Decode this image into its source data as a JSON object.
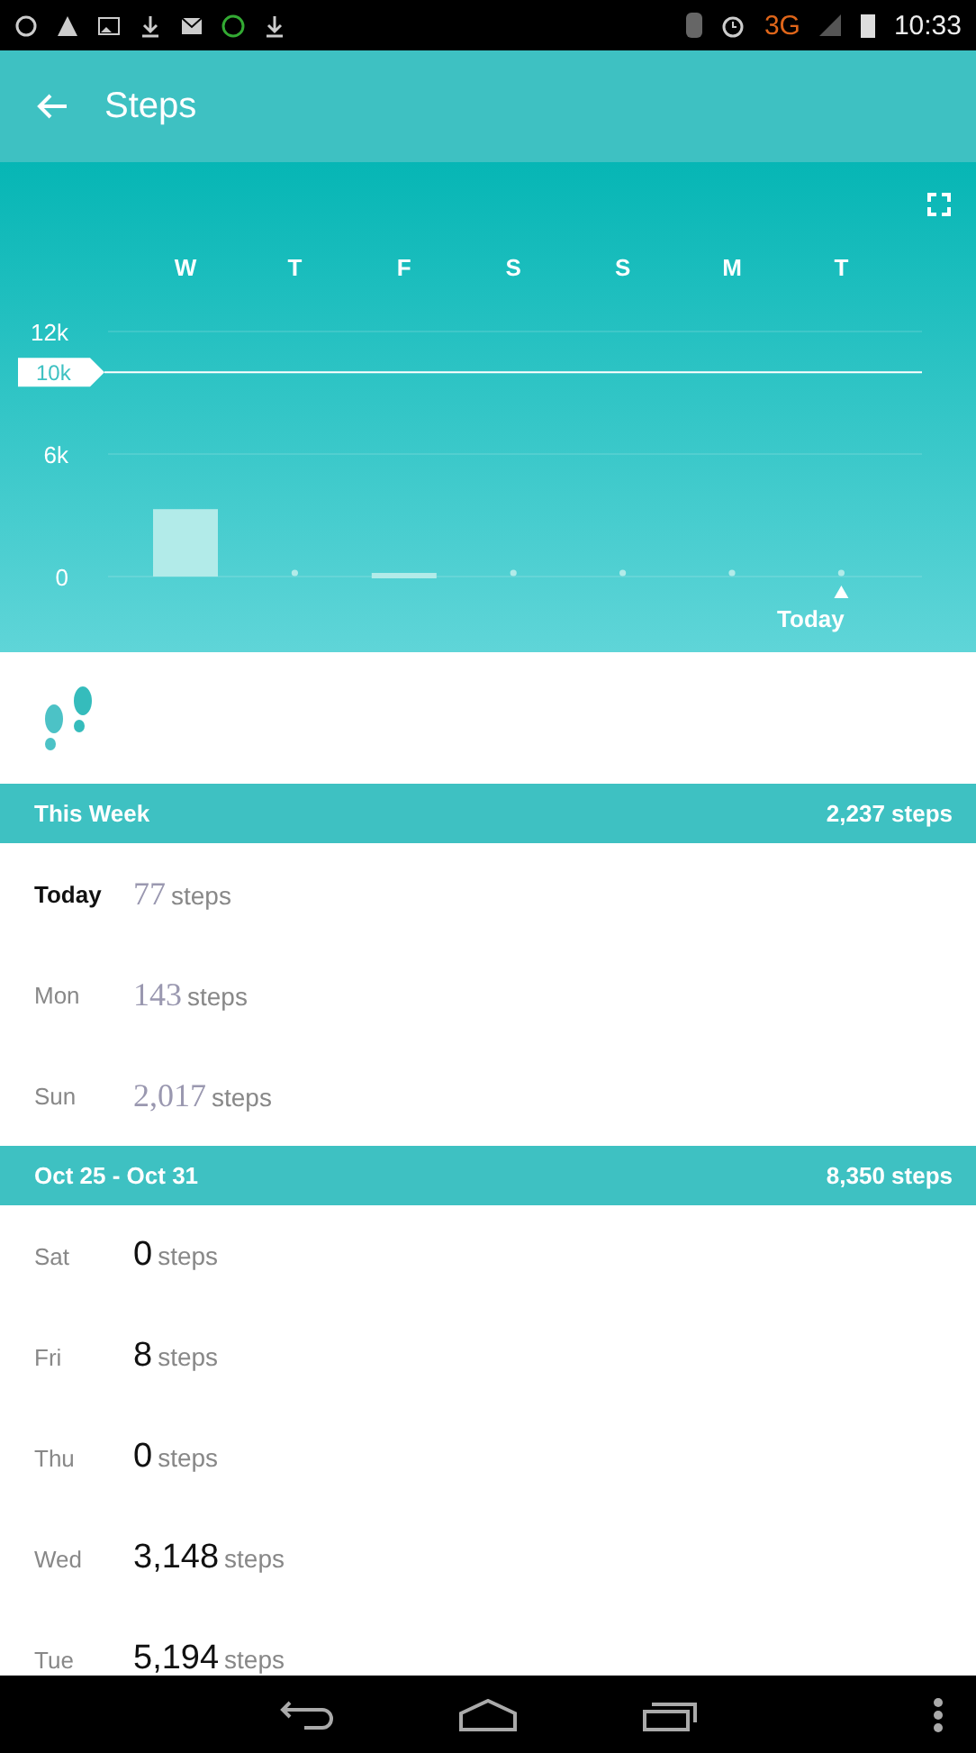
{
  "status_bar": {
    "network": "3G",
    "time": "10:33"
  },
  "app_bar": {
    "title": "Steps"
  },
  "chart": {
    "chart_data": {
      "type": "bar",
      "categories": [
        "W",
        "T",
        "F",
        "S",
        "S",
        "M",
        "T"
      ],
      "values": [
        3300,
        0,
        100,
        0,
        0,
        0,
        0
      ],
      "ylim": [
        0,
        12000
      ],
      "yticks": [
        {
          "value": 0,
          "label": "0"
        },
        {
          "value": 6000,
          "label": "6k"
        },
        {
          "value": 12000,
          "label": "12k"
        }
      ],
      "ref_lines": [
        {
          "axis": "y",
          "value": 10000,
          "label": "10k"
        }
      ],
      "annotations": [
        "Today"
      ]
    }
  },
  "sections": [
    {
      "title": "This Week",
      "total": "2,237 steps",
      "kind": "serif",
      "days": [
        {
          "day": "Today",
          "count": "77",
          "unit": "steps",
          "highlighted": true
        },
        {
          "day": "Mon",
          "count": "143",
          "unit": "steps",
          "highlighted": false
        },
        {
          "day": "Sun",
          "count": "2,017",
          "unit": "steps",
          "highlighted": false
        }
      ]
    },
    {
      "title": "Oct 25 - Oct 31",
      "total": "8,350 steps",
      "kind": "sans",
      "days": [
        {
          "day": "Sat",
          "count": "0",
          "unit": "steps",
          "highlighted": false
        },
        {
          "day": "Fri",
          "count": "8",
          "unit": "steps",
          "highlighted": false
        },
        {
          "day": "Thu",
          "count": "0",
          "unit": "steps",
          "highlighted": false
        },
        {
          "day": "Wed",
          "count": "3,148",
          "unit": "steps",
          "highlighted": false
        },
        {
          "day": "Tue",
          "count": "5,194",
          "unit": "steps",
          "highlighted": false
        }
      ]
    }
  ]
}
